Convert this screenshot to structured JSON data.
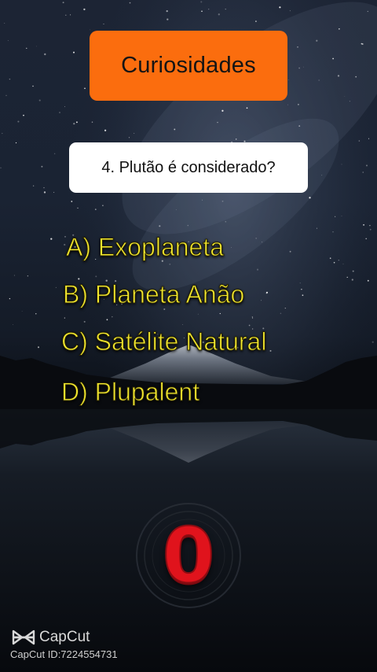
{
  "header": {
    "title": "Curiosidades"
  },
  "question": {
    "text": "4. Plutão é considerado?"
  },
  "options": [
    {
      "label": "A) Exoplaneta"
    },
    {
      "label": "B) Planeta Anão"
    },
    {
      "label": "C) Satélite Natural"
    },
    {
      "label": "D) Plupalent"
    }
  ],
  "timer": {
    "value": "0"
  },
  "watermark": {
    "brand": "CapCut",
    "id_text": "CapCut ID:7224554731"
  },
  "colors": {
    "title_badge": "#fb6d0e",
    "option_text": "#f5ea2e",
    "timer_digit": "#e0131c"
  }
}
